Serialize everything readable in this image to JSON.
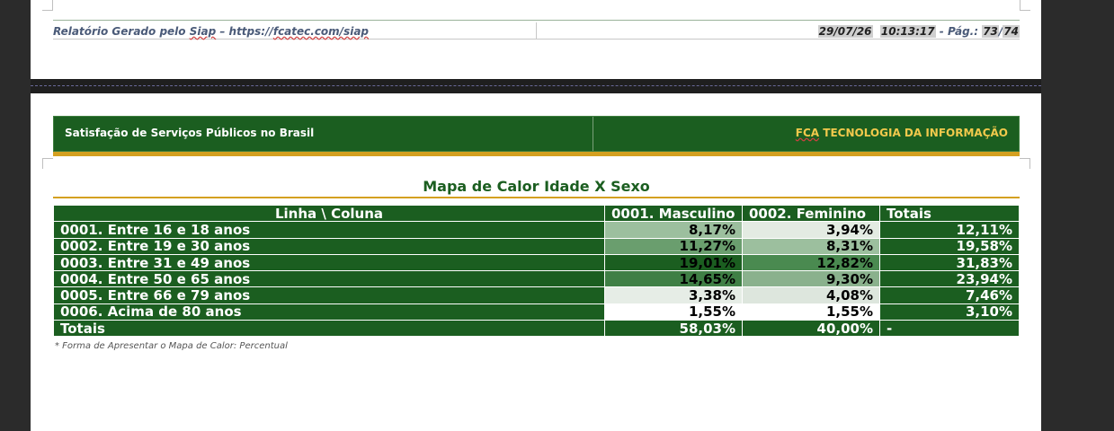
{
  "footer": {
    "left_prefix": "Relatório Gerado pelo ",
    "left_app": "Siap",
    "left_sep": " – https://",
    "left_url": "fcatec.com/siap",
    "date": "29/07/26",
    "time": "10:13:17",
    "page_label": " - Pág.: ",
    "page_current": "73",
    "page_sep": "/",
    "page_total": "74"
  },
  "header": {
    "left_title": "Satisfação de Serviços Públicos no Brasil",
    "right_brand": "FCA",
    "right_rest": " TECNOLOGIA DA INFORMAÇÃO"
  },
  "report": {
    "title": "Mapa de Calor Idade X Sexo",
    "note": "* Forma de Apresentar o Mapa de Calor: Percentual"
  },
  "table": {
    "headers": [
      "Linha \\ Coluna",
      "0001. Masculino",
      "0002. Feminino",
      "Totais"
    ],
    "rows": [
      {
        "label": "0001. Entre 16 e 18 anos",
        "m": "8,17%",
        "f": "3,94%",
        "t": "12,11%",
        "m_color": "#9cbf9e",
        "f_color": "#e3ebe2"
      },
      {
        "label": "0002. Entre 19 e 30 anos",
        "m": "11,27%",
        "f": "8,31%",
        "t": "19,58%",
        "m_color": "#6a9e6e",
        "f_color": "#9cbf9e"
      },
      {
        "label": "0003. Entre 31 e 49 anos",
        "m": "19,01%",
        "f": "12,82%",
        "t": "31,83%",
        "m_color": "#1b5e20",
        "f_color": "#4a8a50"
      },
      {
        "label": "0004. Entre 50 e 65 anos",
        "m": "14,65%",
        "f": "9,30%",
        "t": "23,94%",
        "m_color": "#3f7f45",
        "f_color": "#8ab18d"
      },
      {
        "label": "0005. Entre 66 e 79 anos",
        "m": "3,38%",
        "f": "4,08%",
        "t": "7,46%",
        "m_color": "#e6ede6",
        "f_color": "#dde6dd"
      },
      {
        "label": "0006. Acima de 80 anos",
        "m": "1,55%",
        "f": "1,55%",
        "t": "3,10%",
        "m_color": "#ffffff",
        "f_color": "#ffffff"
      }
    ],
    "totals": {
      "label": "Totais",
      "m": "58,03%",
      "f": "40,00%",
      "t": "-"
    }
  }
}
